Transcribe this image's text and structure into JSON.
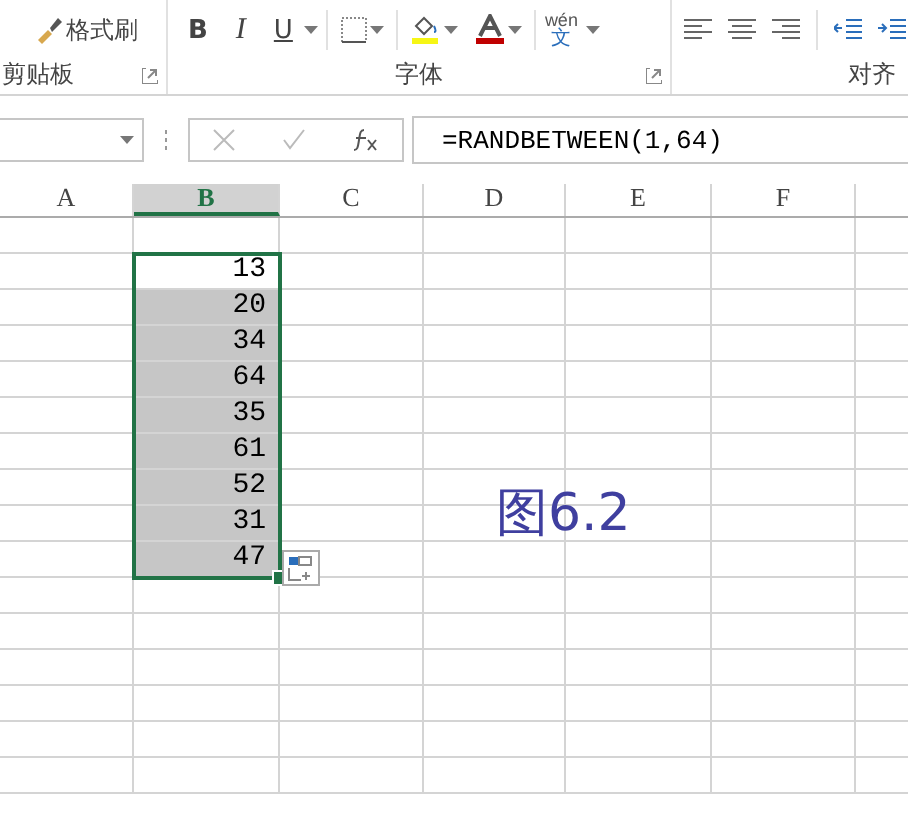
{
  "ribbon": {
    "clipboard": {
      "format_painter": "格式刷",
      "label": "剪贴板"
    },
    "font": {
      "bold": "B",
      "italic": "I",
      "underline": "U",
      "phonetic_top": "wén",
      "phonetic_bottom": "文",
      "label": "字体"
    },
    "alignment": {
      "label": "对齐"
    }
  },
  "formula_bar": {
    "formula": "=RANDBETWEEN(1,64)"
  },
  "columns": [
    {
      "label": "A",
      "selected": false
    },
    {
      "label": "B",
      "selected": true
    },
    {
      "label": "C",
      "selected": false
    },
    {
      "label": "D",
      "selected": false
    },
    {
      "label": "E",
      "selected": false
    },
    {
      "label": "F",
      "selected": false
    }
  ],
  "cells": [
    {
      "value": "13",
      "selected": true,
      "active": true
    },
    {
      "value": "20",
      "selected": true,
      "active": false
    },
    {
      "value": "34",
      "selected": true,
      "active": false
    },
    {
      "value": "64",
      "selected": true,
      "active": false
    },
    {
      "value": "35",
      "selected": true,
      "active": false
    },
    {
      "value": "61",
      "selected": true,
      "active": false
    },
    {
      "value": "52",
      "selected": true,
      "active": false
    },
    {
      "value": "31",
      "selected": true,
      "active": false
    },
    {
      "value": "47",
      "selected": true,
      "active": false
    }
  ],
  "annotation": "图6.2"
}
